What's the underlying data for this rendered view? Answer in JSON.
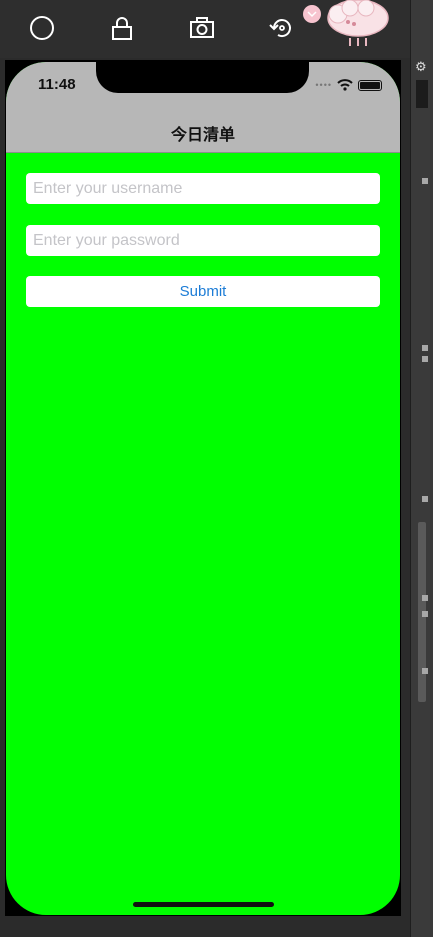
{
  "toolbar": {
    "icons": [
      "home-button-icon",
      "lock-icon",
      "screenshot-camera-icon",
      "rotate-icon"
    ]
  },
  "status_bar": {
    "time": "11:48"
  },
  "nav": {
    "title": "今日清单"
  },
  "form": {
    "username": {
      "value": "",
      "placeholder": "Enter your username"
    },
    "password": {
      "value": "",
      "placeholder": "Enter your password"
    },
    "submit_label": "Submit"
  },
  "colors": {
    "background": "#00ff00",
    "nav_bar": "#b7b7b7",
    "accent": "#1c7cd6"
  }
}
